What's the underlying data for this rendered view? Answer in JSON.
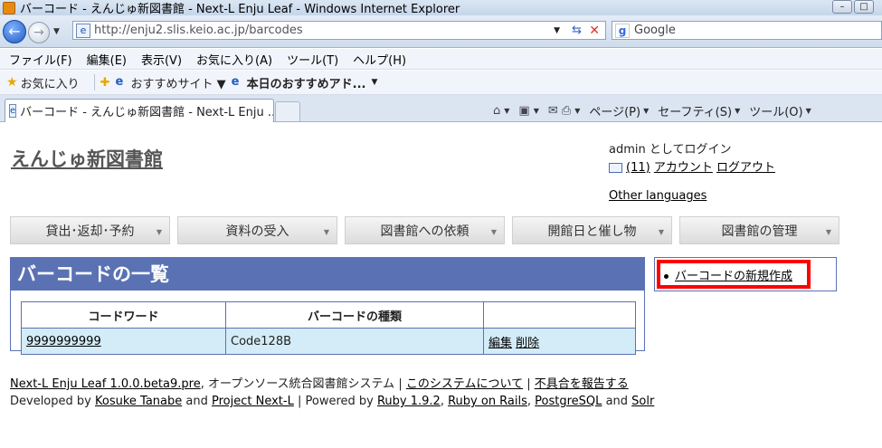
{
  "window": {
    "title": "バーコード - えんじゅ新図書館 - Next-L Enju Leaf - Windows Internet Explorer"
  },
  "navbar": {
    "url": "http://enju2.slis.keio.ac.jp/barcodes",
    "search_placeholder": "Google"
  },
  "menubar": {
    "items": [
      "ファイル(F)",
      "編集(E)",
      "表示(V)",
      "お気に入り(A)",
      "ツール(T)",
      "ヘルプ(H)"
    ]
  },
  "favorites_bar": {
    "favorites_label": "お気に入り",
    "items": [
      "おすすめサイト ▼",
      "本日のおすすめアド..."
    ]
  },
  "tabs": {
    "active_tab": "バーコード - えんじゅ新図書館 - Next-L Enju ..."
  },
  "command_bar": {
    "page": "ページ(P)",
    "safety": "セーフティ(S)",
    "tools": "ツール(O)"
  },
  "header": {
    "site_title": "えんじゅ新図書館",
    "login_status": "admin としてログイン",
    "mail_count": "(11)",
    "account": "アカウント",
    "logout": "ログアウト",
    "other_languages": "Other languages"
  },
  "main_menu": {
    "items": [
      "貸出･返却･予約",
      "資料の受入",
      "図書館への依頼",
      "開館日と催し物",
      "図書館の管理"
    ]
  },
  "barcodes": {
    "heading": "バーコードの一覧",
    "columns": [
      "コードワード",
      "バーコードの種類",
      ""
    ],
    "rows": [
      {
        "code_word": "9999999999",
        "barcode_type": "Code128B",
        "edit": "編集",
        "delete": "削除"
      }
    ]
  },
  "sidebar": {
    "new_barcode": "バーコードの新規作成"
  },
  "footer": {
    "product": "Next-L Enju Leaf 1.0.0.beta9.pre",
    "product_desc": ", オープンソース統合図書館システム",
    "sep1": "|",
    "about": "このシステムについて",
    "sep2": "|",
    "report": "不具合を報告する",
    "developed_by": "Developed by",
    "developer1": "Kosuke Tanabe",
    "and1": "and",
    "developer2": "Project Next-L",
    "powered_sep": "| Powered by",
    "ruby": "Ruby 1.9.2",
    "rails": "Ruby on Rails",
    "postgres": "PostgreSQL",
    "and2": "and",
    "solr": "Solr"
  }
}
